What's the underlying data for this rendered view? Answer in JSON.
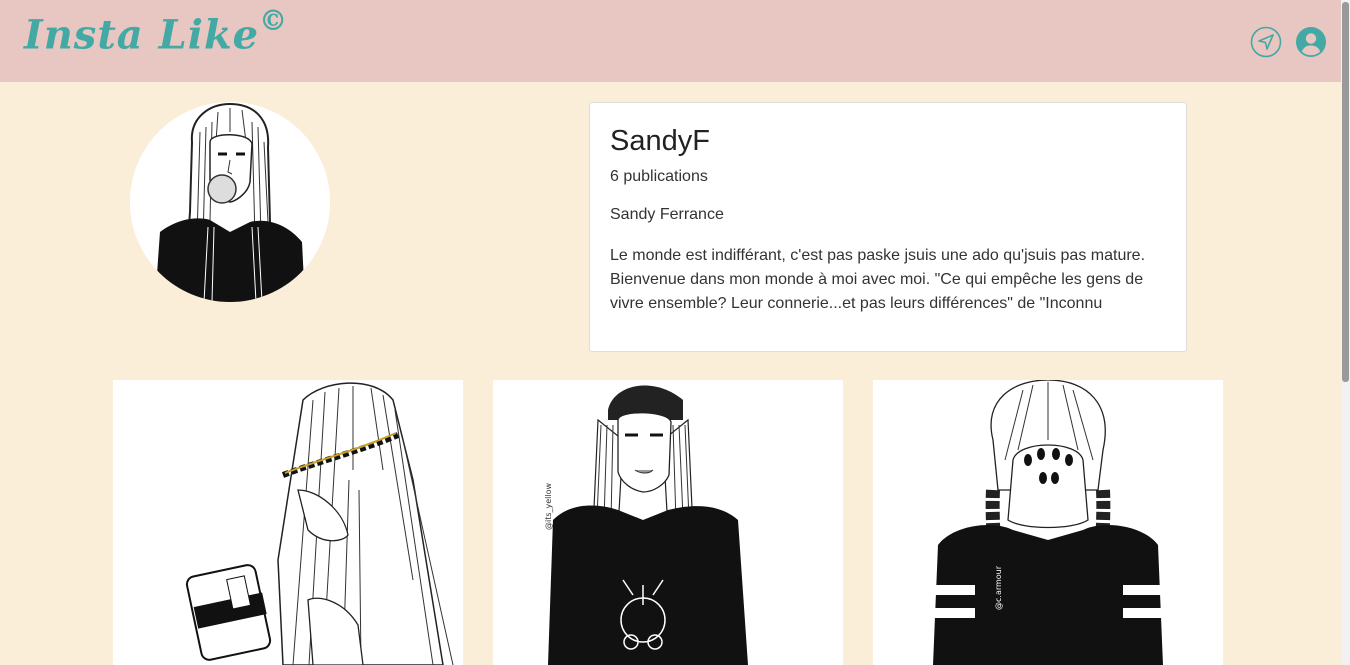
{
  "app": {
    "brand": "Insta Like",
    "brand_mark": "©"
  },
  "colors": {
    "navbar": "#e8c6c2",
    "page_background": "#fbeed8",
    "accent": "#43a9a4"
  },
  "nav": {
    "icons": [
      "send-icon",
      "user-account-icon"
    ]
  },
  "profile": {
    "username": "SandyF",
    "publications": "6 publications",
    "full_name": "Sandy Ferrance",
    "bio": "Le monde est indifférant, c'est pas paske jsuis une ado qu'jsuis pas mature. Bienvenue dans mon monde à moi avec moi. \"Ce qui empêche les gens de vivre ensemble? Leur connerie...et pas leurs différences\" de \"Inconnu"
  },
  "posts": {
    "count_visible": 3,
    "watermarks": [
      "@its_yellow",
      "@c.armour"
    ]
  }
}
